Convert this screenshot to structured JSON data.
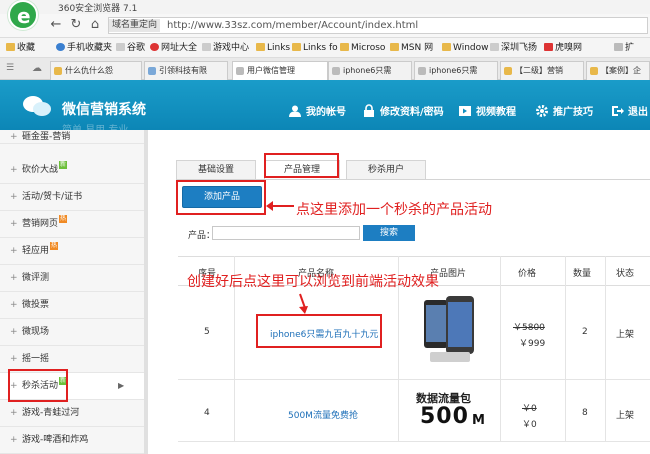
{
  "browser": {
    "title": "360安全浏览器 7.1",
    "url_chip": "域名重定向",
    "url": "http://www.33sz.com/member/Account/index.html",
    "bookmarks": [
      "收藏",
      "手机收藏夹",
      "谷歌",
      "网址大全",
      "游戏中心",
      "Links",
      "Links fo",
      "Microso",
      "MSN 网",
      "Window",
      "深圳飞扬",
      "虎嗅网",
      "扩"
    ],
    "tabs": [
      "什么仇什么怨",
      "引领科技有限",
      "用户微信管理",
      "iphone6只需",
      "iphone6只需",
      "【二级】营销",
      "【案例】企"
    ]
  },
  "header": {
    "title": "微信营销系统",
    "ghost": "简单 易用 专业",
    "nav": [
      "我的帐号",
      "修改资料/密码",
      "视频教程",
      "推广技巧",
      "退出"
    ]
  },
  "sidebar": {
    "items": [
      {
        "label": "砸金蛋-营销",
        "badge": ""
      },
      {
        "label": "砍价大战",
        "badge": "新"
      },
      {
        "label": "活动/贺卡/证书",
        "badge": ""
      },
      {
        "label": "营销网页",
        "badge": "热"
      },
      {
        "label": "轻应用",
        "badge": "热"
      },
      {
        "label": "微评测",
        "badge": ""
      },
      {
        "label": "微投票",
        "badge": ""
      },
      {
        "label": "微现场",
        "badge": ""
      },
      {
        "label": "摇一摇",
        "badge": ""
      },
      {
        "label": "秒杀活动",
        "badge": "新"
      },
      {
        "label": "游戏-青蛙过河",
        "badge": ""
      },
      {
        "label": "游戏-啤酒和炸鸡",
        "badge": ""
      }
    ]
  },
  "content": {
    "tabs": [
      "基础设置",
      "产品管理",
      "秒杀用户"
    ],
    "add_button": "添加产品",
    "note_add": "点这里添加一个秒杀的产品活动",
    "note_browse": "创建好后点这里可以浏览到前端活动效果",
    "search_label": "产品：",
    "search_placeholder": "",
    "search_button": "搜索",
    "columns": [
      "序号",
      "产品名称",
      "产品图片",
      "价格",
      "数量",
      "状态"
    ],
    "rows": [
      {
        "id": "5",
        "name": "iphone6只需九百九十九元",
        "old_price": "￥5800",
        "price": "￥999",
        "qty": "2",
        "status": "上架"
      },
      {
        "id": "4",
        "name": "500M流量免费抢",
        "image_text_1": "数据流量包",
        "image_text_2": "500",
        "image_text_unit": "M",
        "old_price": "￥0",
        "price": "￥0",
        "qty": "8",
        "status": "上架"
      }
    ]
  },
  "colors": {
    "header": "#1390c0",
    "accent": "#1d7ec2",
    "annotation": "#e02020"
  }
}
